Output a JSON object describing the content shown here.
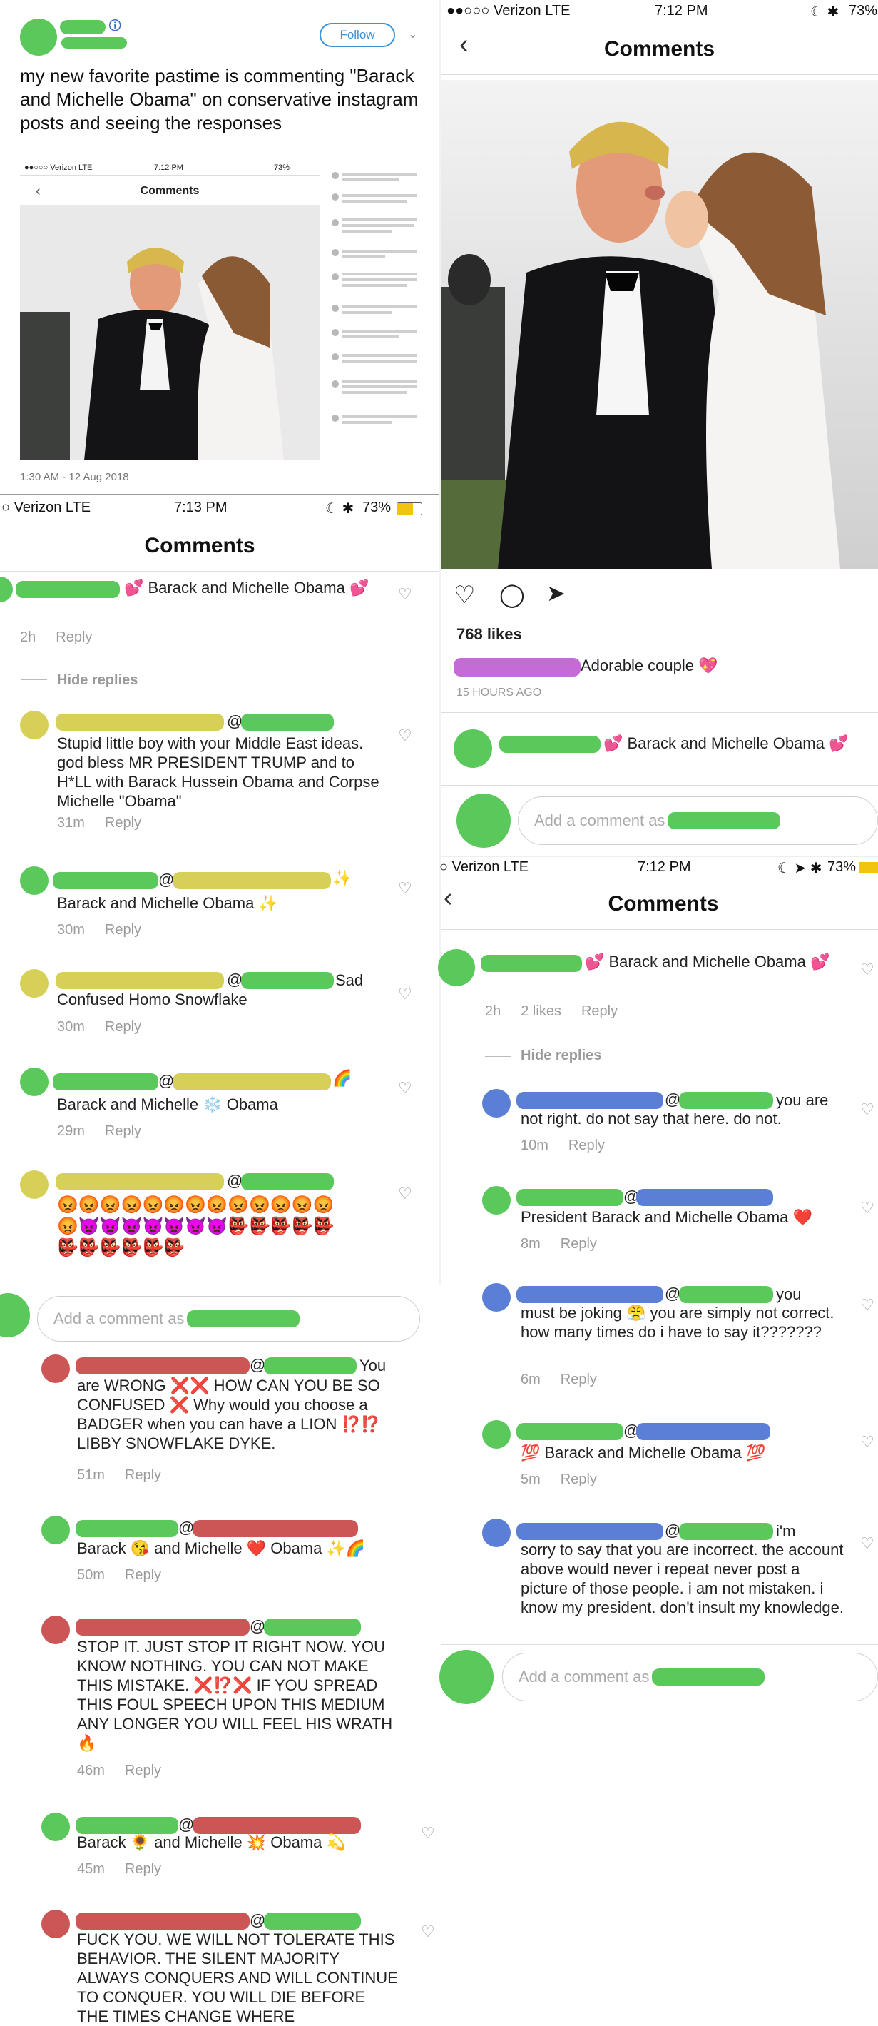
{
  "tweet": {
    "follow_label": "Follow",
    "text": "my new favorite pastime is commenting \"Barack and Michelle Obama\" on conservative instagram posts and seeing the responses",
    "timestamp": "1:30 AM - 12 Aug 2018",
    "mini_status": {
      "carrier": "●●○○○ Verizon  LTE",
      "time": "7:12 PM",
      "battery": "73%"
    },
    "mini_header": "Comments"
  },
  "top_right": {
    "status": {
      "carrier": "●●○○○ Verizon   LTE",
      "time": "7:12 PM",
      "battery": "73%"
    },
    "header": "Comments",
    "likes": "768 likes",
    "caption": "Adorable couple 💖",
    "time_ago": "15 HOURS AGO",
    "comment": "💕  Barack and Michelle Obama 💕",
    "add_placeholder": "Add a comment as"
  },
  "left_panel": {
    "status": {
      "carrier": "○ Verizon   LTE",
      "time": "7:13 PM",
      "battery": "73%"
    },
    "header": "Comments",
    "first": {
      "text": "💕  Barack and Michelle Obama 💕",
      "time": "2h",
      "reply": "Reply"
    },
    "hide_replies": "Hide replies",
    "replies": [
      {
        "text": "Stupid little boy with your Middle East ideas. god bless MR PRESIDENT TRUMP and to H*LL with Barack Hussein Obama and Corpse Michelle \"Obama\"",
        "time": "31m",
        "reply": "Reply"
      },
      {
        "text": "Barack and Michelle Obama ✨",
        "time": "30m",
        "reply": "Reply"
      },
      {
        "text": "Confused Homo Snowflake",
        "prefix": "Sad",
        "time": "30m",
        "reply": "Reply"
      },
      {
        "text": "Barack and Michelle ❄️ Obama",
        "time": "29m",
        "reply": "Reply"
      },
      {
        "text": "😡😡😡😡😡😡😡😡😡😡😡😡😡 😡👿👿👿👿👿👿👿👺👺👺👺👺👺👺👺👺👺👺"
      }
    ],
    "add_placeholder": "Add a comment as"
  },
  "bottom_left": {
    "comments": [
      {
        "text": "are WRONG ❌❌ HOW CAN YOU BE SO CONFUSED ❌ Why would you choose a BADGER when you can have a LION ⁉️⁉️ LIBBY SNOWFLAKE DYKE.",
        "prefix": "You",
        "time": "51m",
        "reply": "Reply"
      },
      {
        "text": "Barack 😘 and Michelle ❤️ Obama ✨🌈",
        "time": "50m",
        "reply": "Reply"
      },
      {
        "text": "STOP IT. JUST STOP IT RIGHT NOW. YOU KNOW NOTHING. YOU CAN NOT MAKE THIS MISTAKE. ❌⁉️❌ IF YOU SPREAD THIS FOUL SPEECH UPON THIS MEDIUM ANY LONGER YOU WILL FEEL HIS WRATH 🔥",
        "time": "46m",
        "reply": "Reply"
      },
      {
        "text": "Barack 🌻 and Michelle 💥 Obama 💫",
        "time": "45m",
        "reply": "Reply"
      },
      {
        "text": "FUCK YOU. WE WILL NOT TOLERATE THIS BEHAVIOR. THE SILENT MAJORITY ALWAYS CONQUERS AND WILL CONTINUE TO CONQUER. YOU WILL DIE BEFORE THE TIMES CHANGE WHERE"
      }
    ]
  },
  "right_panel": {
    "status": {
      "carrier": "○ Verizon   LTE",
      "time": "7:12 PM",
      "battery": "73%"
    },
    "header": "Comments",
    "first": {
      "text": "💕  Barack and Michelle Obama 💕",
      "time": "2h",
      "likes": "2 likes",
      "reply": "Reply"
    },
    "hide_replies": "Hide replies",
    "replies": [
      {
        "prefix": "you are",
        "text": "not right. do not say that here. do not.",
        "time": "10m",
        "reply": "Reply"
      },
      {
        "text": "President Barack and Michelle Obama ❤️",
        "time": "8m",
        "reply": "Reply"
      },
      {
        "prefix": "you",
        "text": "must be joking 😤 you are simply not correct. how many times do i have to say it???????",
        "time": "6m",
        "reply": "Reply"
      },
      {
        "text": "💯 Barack and Michelle Obama 💯",
        "time": "5m",
        "reply": "Reply"
      },
      {
        "prefix": "i'm",
        "text": "sorry to say that you are incorrect. the account above would never i repeat never post a picture of those people. i am not mistaken. i know my president. don't insult my knowledge."
      }
    ],
    "add_placeholder": "Add a comment as"
  }
}
